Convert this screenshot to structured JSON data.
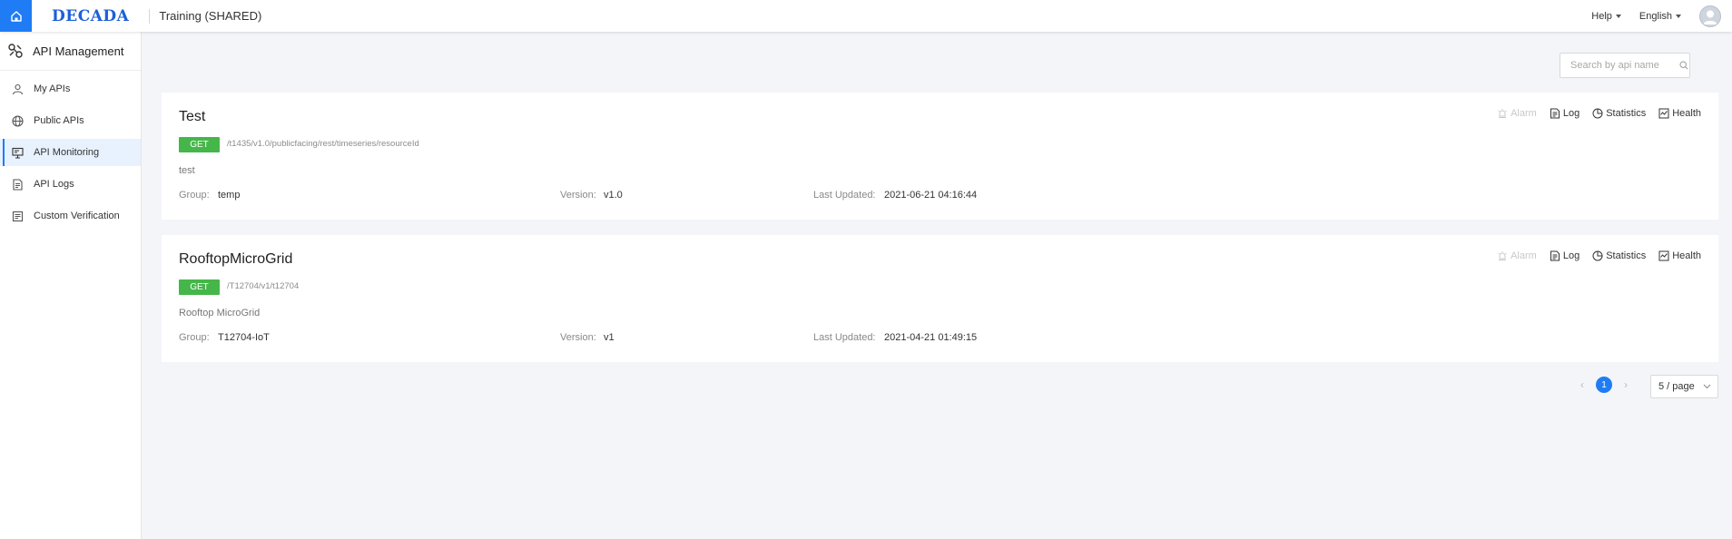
{
  "header": {
    "logo": "DECADA",
    "workspace": "Training (SHARED)",
    "help_label": "Help",
    "language_label": "English"
  },
  "sidebar": {
    "title": "API Management",
    "items": [
      {
        "label": "My APIs",
        "icon": "user-icon"
      },
      {
        "label": "Public APIs",
        "icon": "globe-icon"
      },
      {
        "label": "API Monitoring",
        "icon": "monitor-icon",
        "active": true
      },
      {
        "label": "API Logs",
        "icon": "document-icon"
      },
      {
        "label": "Custom Verification",
        "icon": "checklist-icon"
      }
    ]
  },
  "search": {
    "placeholder": "Search by api name",
    "value": ""
  },
  "labels": {
    "group": "Group:",
    "version": "Version:",
    "last_updated": "Last Updated:"
  },
  "actions": {
    "alarm": "Alarm",
    "log": "Log",
    "statistics": "Statistics",
    "health": "Health"
  },
  "apis": [
    {
      "name": "Test",
      "method": "GET",
      "path": "/t1435/v1.0/publicfacing/rest/timeseries/resourceId",
      "description": "test",
      "group": "temp",
      "version": "v1.0",
      "last_updated": "2021-06-21 04:16:44"
    },
    {
      "name": "RooftopMicroGrid",
      "method": "GET",
      "path": "/T12704/v1/t12704",
      "description": "Rooftop MicroGrid",
      "group": "T12704-IoT",
      "version": "v1",
      "last_updated": "2021-04-21 01:49:15"
    }
  ],
  "pagination": {
    "current_page": "1",
    "page_size": "5 / page"
  },
  "colors": {
    "accent": "#1f7cf4",
    "method_get": "#45b649"
  }
}
